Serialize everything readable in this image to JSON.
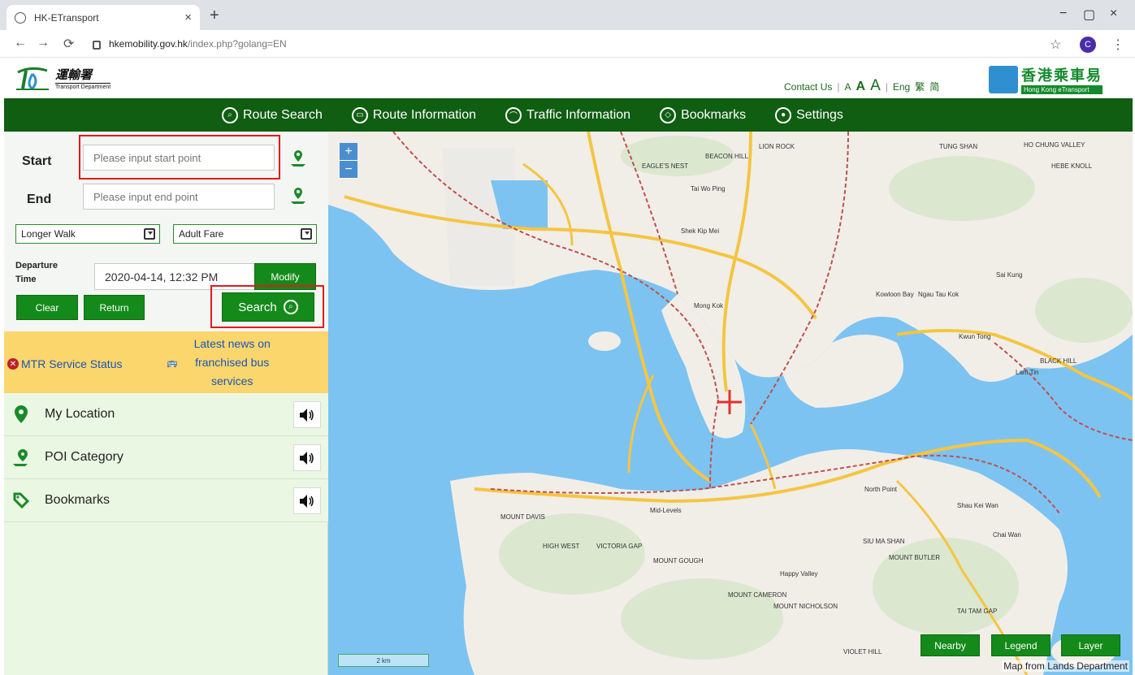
{
  "browser": {
    "tab_title": "HK-ETransport",
    "tab_close": "×",
    "new_tab": "+",
    "url_host": "hkemobility.gov.hk",
    "url_path": "/index.php?golang=EN",
    "profile_initial": "C",
    "controls": {
      "minimize": "−",
      "maximize": "▢",
      "close": "×"
    }
  },
  "header": {
    "td_logo_cn": "運輸署",
    "td_logo_en": "Transport Department",
    "contact_us": "Contact Us",
    "sep": "|",
    "font_small": "A",
    "font_medium": "A",
    "font_large": "A",
    "lang_en": "Eng",
    "lang_tc": "繁",
    "lang_sc": "简",
    "eco_logo_cn": "香港乘車易",
    "eco_logo_en": "Hong Kong eTransport"
  },
  "nav": {
    "items": [
      {
        "label": "Route Search",
        "icon": "search-icon"
      },
      {
        "label": "Route Information",
        "icon": "bus-icon"
      },
      {
        "label": "Traffic Information",
        "icon": "traffic-icon"
      },
      {
        "label": "Bookmarks",
        "icon": "bookmark-icon"
      },
      {
        "label": "Settings",
        "icon": "gear-icon"
      }
    ]
  },
  "form": {
    "start_label": "Start",
    "start_placeholder": "Please input start point",
    "end_label": "End",
    "end_placeholder": "Please input end point",
    "walk_option": "Longer Walk",
    "fare_option": "Adult Fare",
    "departure_label_1": "Departure",
    "departure_label_2": "Time",
    "departure_value": "2020-04-14, 12:32 PM",
    "modify": "Modify",
    "clear": "Clear",
    "return": "Return",
    "search": "Search"
  },
  "status": {
    "mtr": "MTR Service Status",
    "bus_news_1": "Latest news on",
    "bus_news_2": "franchised bus",
    "bus_news_3": "services"
  },
  "list": {
    "items": [
      {
        "label": "My Location"
      },
      {
        "label": "POI Category"
      },
      {
        "label": "Bookmarks"
      }
    ]
  },
  "map": {
    "zoom_in": "+",
    "zoom_out": "−",
    "scale": "2 km",
    "nearby": "Nearby",
    "legend": "Legend",
    "layer": "Layer",
    "credit": "Map from Lands Department",
    "places": [
      "LION ROCK",
      "TUNG SHAN",
      "HO CHUNG VALLEY",
      "HEBE KNOLL",
      "BEACON HILL",
      "EAGLE'S NEST",
      "Tai Wo Ping",
      "Shek Kip Mei",
      "Mong Kok",
      "Kowloon Bay",
      "Ngau Tau Kok",
      "Sai Kung",
      "Kwun Tong",
      "Lam Tin",
      "BLACK HILL",
      "Mid-Levels",
      "North Point",
      "MOUNT DAVIS",
      "HIGH WEST",
      "VICTORIA GAP",
      "MOUNT GOUGH",
      "MOUNT CAMERON",
      "Happy Valley",
      "MOUNT NICHOLSON",
      "Shau Kei Wan",
      "Chai Wan",
      "TAI TAM GAP",
      "VIOLET HILL",
      "SIU MA SHAN",
      "MOUNT BUTLER"
    ]
  }
}
